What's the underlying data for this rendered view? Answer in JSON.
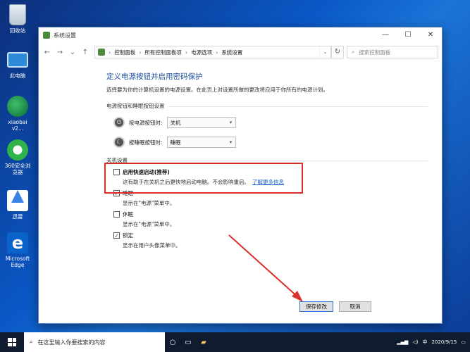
{
  "desktop": {
    "icons": [
      {
        "label": "回收站",
        "icon": "recycle-bin-icon"
      },
      {
        "label": "此电脑",
        "icon": "this-pc-icon"
      },
      {
        "label": "xiaobai v2...",
        "icon": "xiaobai-icon"
      },
      {
        "label": "360安全浏览器",
        "icon": "360-browser-icon"
      },
      {
        "label": "迅雷",
        "icon": "xunlei-icon"
      },
      {
        "label": "Microsoft Edge",
        "icon": "edge-icon"
      }
    ]
  },
  "window": {
    "title": "系统设置",
    "controls": {
      "minimize": "—",
      "maximize": "☐",
      "close": "✕"
    },
    "nav": {
      "back": "←",
      "forward": "→",
      "up": "↑"
    },
    "address": {
      "crumbs": [
        "控制面板",
        "所有控制面板项",
        "电源选项",
        "系统设置"
      ],
      "refresh": "↻"
    },
    "search": {
      "placeholder": "搜索控制面板"
    },
    "heading": "定义电源按钮并启用密码保护",
    "description": "选择要为你的计算机设置的电源设置。在此页上对设置所做的更改将应用于你所有的电源计划。",
    "power_section": {
      "title": "电源按钮和睡眠按钮设置",
      "power_button": {
        "label": "按电源按钮时:",
        "value": "关机"
      },
      "sleep_button": {
        "label": "按睡眠按钮时:",
        "value": "睡眠"
      }
    },
    "shutdown_section": {
      "title": "关机设置",
      "options": [
        {
          "label": "启用快速启动(推荐)",
          "checked": false,
          "description": "这有助于在关机之后更快地启动电脑。不会影响重启。",
          "link": "了解更多信息"
        },
        {
          "label": "睡眠",
          "checked": true,
          "description": "显示在\"电源\"菜单中。"
        },
        {
          "label": "休眠",
          "checked": false,
          "description": "显示在\"电源\"菜单中。"
        },
        {
          "label": "锁定",
          "checked": true,
          "description": "显示在用户头像菜单中。"
        }
      ]
    },
    "buttons": {
      "save": "保存修改",
      "cancel": "取消"
    }
  },
  "taskbar": {
    "search_placeholder": "在这里输入你要搜索的内容",
    "tray": {
      "ime": "中",
      "date": "2020/9/15"
    }
  },
  "colors": {
    "highlight": "#d8302a",
    "heading": "#1c4f9c",
    "link": "#1a5fcc"
  }
}
